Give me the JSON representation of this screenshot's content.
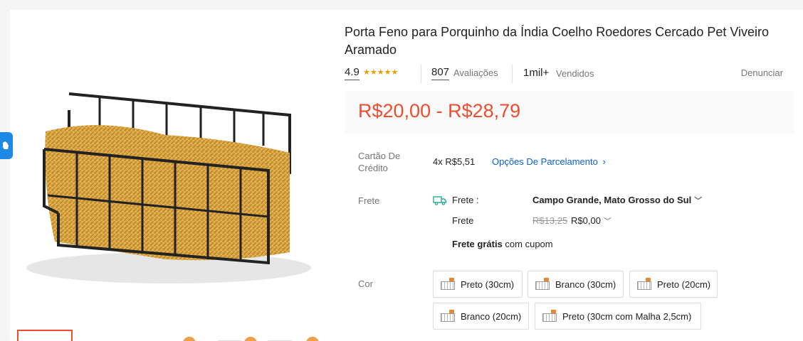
{
  "product": {
    "title": "Porta Feno para Porquinho da Índia Coelho Roedores Cercado Pet Viveiro Aramado",
    "rating": "4.9",
    "reviews_count": "807",
    "reviews_label": "Avaliações",
    "sold_count": "1mil+",
    "sold_label": "Vendidos",
    "report_label": "Denunciar",
    "price_range": "R$20,00 - R$28,79"
  },
  "credit": {
    "label": "Cartão De Crédito",
    "installments": "4x R$5,51",
    "options_link": "Opções De Parcelamento"
  },
  "shipping": {
    "label": "Frete",
    "head_label": "Frete :",
    "destination": "Campo Grande, Mato Grosso do Sul",
    "row_label": "Frete",
    "old_price": "R$13,25",
    "new_price": "R$0,00",
    "free_bold": "Frete grátis",
    "free_rest": " com cupom"
  },
  "color": {
    "label": "Cor",
    "options": [
      "Preto (30cm)",
      "Branco (30cm)",
      "Preto (20cm)",
      "Branco (20cm)",
      "Preto (30cm com Malha 2,5cm)"
    ]
  },
  "colors": {
    "accent": "#ee4d2d",
    "link": "#0b5ed7",
    "star": "#ee9b00",
    "side_tab": "#1e88e5"
  },
  "icons": {
    "stars": "star-icon",
    "truck": "truck-icon",
    "chevron": "chevron-down-icon",
    "arrow": "chevron-right-icon"
  }
}
